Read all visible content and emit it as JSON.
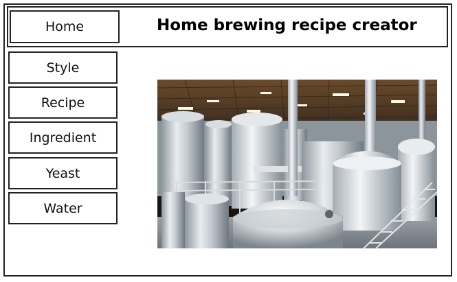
{
  "header": {
    "title": "Home brewing recipe creator",
    "home_label": "Home"
  },
  "sidebar": {
    "items": [
      {
        "label": "Style"
      },
      {
        "label": "Recipe"
      },
      {
        "label": "Ingredient"
      },
      {
        "label": "Yeast"
      },
      {
        "label": "Water"
      }
    ]
  },
  "main": {
    "image_subject": "brewery-photo"
  }
}
